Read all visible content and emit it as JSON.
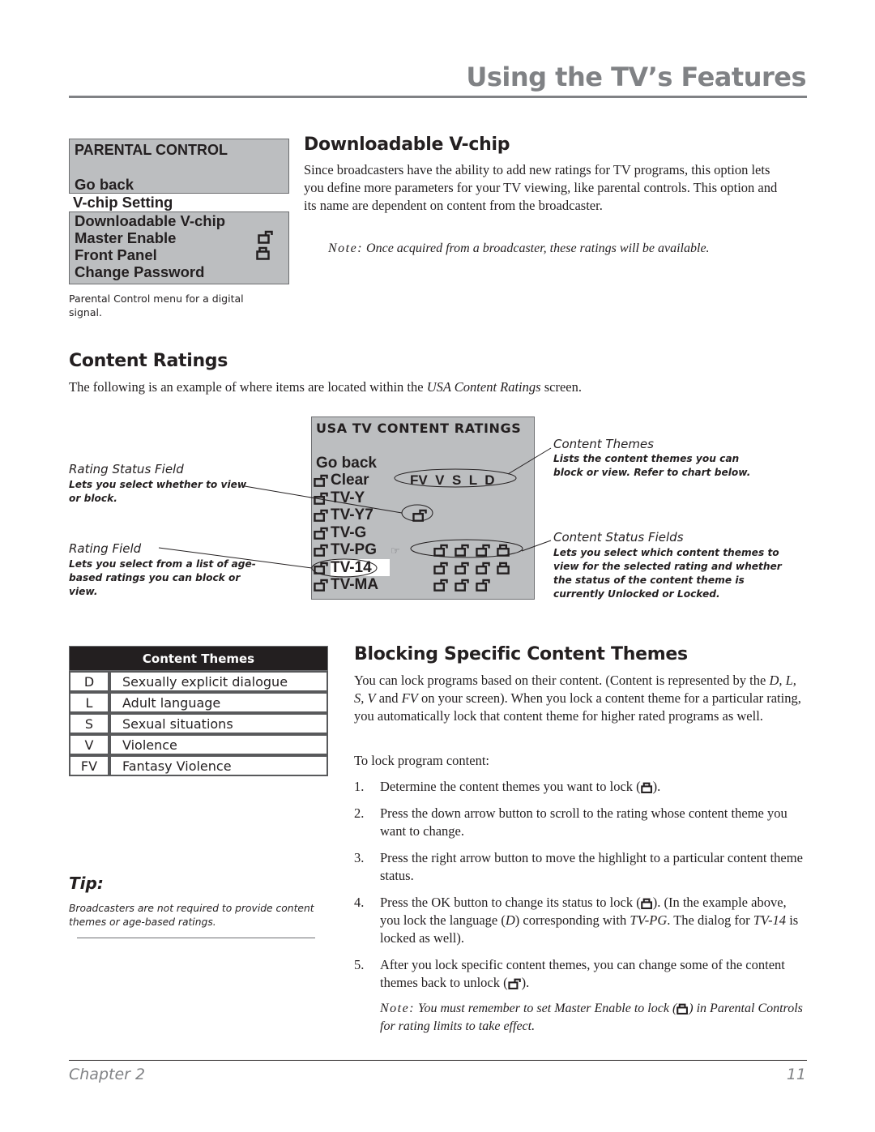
{
  "header": {
    "title": "Using the TV’s Features"
  },
  "parental_menu": {
    "title": "PARENTAL CONTROL",
    "go_back": "Go back",
    "section": "V-chip Setting",
    "items": [
      {
        "label": "Downloadable V-chip",
        "icon": ""
      },
      {
        "label": "Master Enable",
        "icon": "unlock-icon"
      },
      {
        "label": "Front Panel",
        "icon": "lock-icon"
      },
      {
        "label": "Change Password",
        "icon": ""
      }
    ],
    "caption": "Parental Control menu for a digital signal."
  },
  "downloadable": {
    "heading": "Downloadable V-chip",
    "body": "Since broadcasters have the ability to add new ratings for TV programs, this option lets you define more parameters for your TV viewing, like parental controls. This option and its name are dependent on content from the broadcaster.",
    "note_label": "Note:",
    "note_text": " Once acquired from a broadcaster, these ratings will be available."
  },
  "content_ratings": {
    "heading": "Content Ratings",
    "intro_before": "The following is an example of where items are located within the ",
    "intro_italic": "USA Content Ratings",
    "intro_after": " screen."
  },
  "usa_screen": {
    "title": "USA TV CONTENT RATINGS",
    "go_back": "Go back",
    "themes_header": "FV  V  S  L  D",
    "ratings": [
      {
        "label": "Clear",
        "status": "unlocked",
        "themes": []
      },
      {
        "label": "TV-Y",
        "status": "unlocked",
        "themes": []
      },
      {
        "label": "TV-Y7",
        "status": "unlocked",
        "themes": [
          "unlocked"
        ]
      },
      {
        "label": "TV-G",
        "status": "unlocked",
        "themes": []
      },
      {
        "label": "TV-PG",
        "status": "unlocked",
        "themes": [
          "unlocked",
          "unlocked",
          "unlocked",
          "locked"
        ],
        "pointer": true
      },
      {
        "label": "TV-14",
        "status": "unlocked",
        "themes": [
          "unlocked",
          "unlocked",
          "unlocked",
          "locked"
        ],
        "highlighted": true
      },
      {
        "label": "TV-MA",
        "status": "unlocked",
        "themes": [
          "unlocked",
          "unlocked",
          "unlocked"
        ]
      }
    ]
  },
  "callouts": {
    "rating_status": {
      "title": "Rating Status Field",
      "desc": "Lets you select whether to view or block."
    },
    "rating_field": {
      "title": "Rating Field",
      "desc": "Lets you select from a list of age-based ratings you can block or view."
    },
    "content_themes": {
      "title": "Content Themes",
      "desc": "Lists the content themes you can block or view. Refer to chart below."
    },
    "content_status": {
      "title": "Content Status Fields",
      "desc": "Lets you select which content themes to view for the selected rating and whether the status of the content theme is currently Unlocked or Locked."
    }
  },
  "themes_table": {
    "header": "Content Themes",
    "rows": [
      {
        "code": "D",
        "desc": "Sexually explicit dialogue"
      },
      {
        "code": "L",
        "desc": "Adult language"
      },
      {
        "code": "S",
        "desc": "Sexual situations"
      },
      {
        "code": "V",
        "desc": "Violence"
      },
      {
        "code": "FV",
        "desc": "Fantasy Violence"
      }
    ]
  },
  "tip": {
    "title": "Tip:",
    "text": "Broadcasters are not required to provide content themes or age-based ratings."
  },
  "blocking": {
    "heading": "Blocking Specific Content Themes",
    "p1_a": "You can lock programs based on their content. (Content is represented by the ",
    "p1_codes": "D, L, S, V",
    "p1_b": " and ",
    "p1_fv": "FV",
    "p1_c": " on your screen). When you lock a content theme for a particular rating, you automatically lock that content theme for higher rated programs as well.",
    "lead": "To lock program content:",
    "steps": [
      {
        "num": "1.",
        "a": "Determine the content themes you want to lock (",
        "b": ")."
      },
      {
        "num": "2.",
        "a": "Press the down arrow button to scroll to the rating whose content theme you want to change."
      },
      {
        "num": "3.",
        "a": "Press the right arrow button to move the highlight to a particular content theme status."
      },
      {
        "num": "4.",
        "a": "Press the OK button to change its status to lock (",
        "b": "). (In the example above, you lock the language (",
        "c": "D",
        "d": ") corresponding with ",
        "e": "TV-PG",
        "f": ". The dialog for ",
        "g": "TV-14",
        "h": " is locked as well)."
      },
      {
        "num": "5.",
        "a": "After you lock specific content themes, you can change some of the content themes back to unlock (",
        "b": ")."
      }
    ],
    "note_label": "Note:",
    "note_a": " You must remember to set Master Enable to lock (",
    "note_b": ") in Parental Controls for rating limits to take effect."
  },
  "footer": {
    "chapter": "Chapter 2",
    "page": "11"
  }
}
